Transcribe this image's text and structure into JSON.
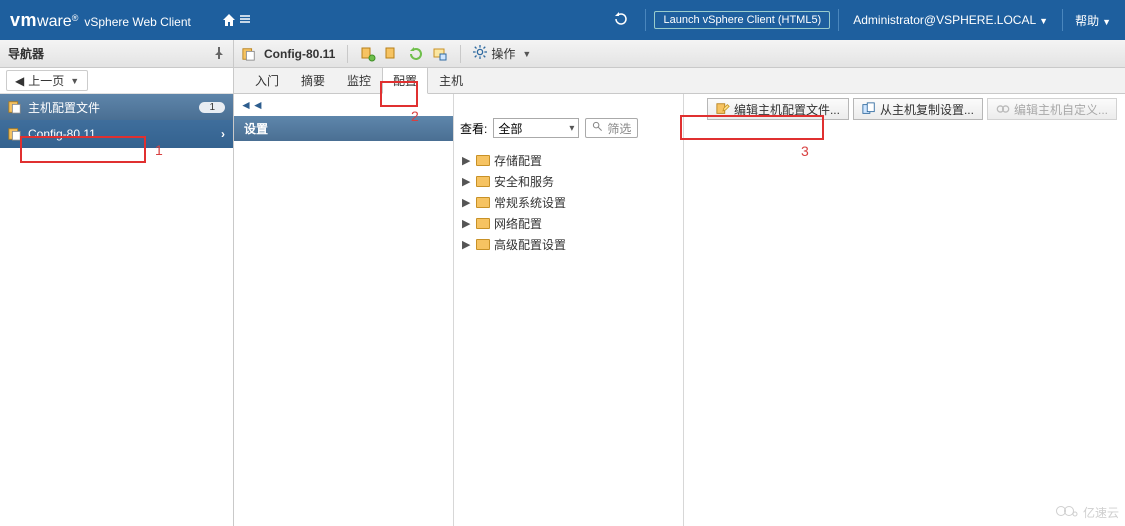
{
  "topbar": {
    "brand_vm": "vm",
    "brand_ware": "ware",
    "brand_reg": "®",
    "brand_product": "vSphere Web Client",
    "launch_label": "Launch vSphere Client (HTML5)",
    "user_label": "Administrator@VSPHERE.LOCAL",
    "help_label": "帮助"
  },
  "navigator": {
    "title": "导航器",
    "back_label": "上一页",
    "category_label": "主机配置文件",
    "category_badge": "1",
    "selected_label": "Config-80.11"
  },
  "objectbar": {
    "name": "Config-80.11",
    "actions_label": "操作"
  },
  "tabs": {
    "t1": "入门",
    "t2": "摘要",
    "t3": "监控",
    "t4": "配置",
    "t5": "主机"
  },
  "settings": {
    "header": "设置",
    "collapse": "◄◄"
  },
  "mid": {
    "view_label": "查看:",
    "view_selected": "全部",
    "filter_placeholder": "筛选",
    "tree": {
      "i1": "存储配置",
      "i2": "安全和服务",
      "i3": "常规系统设置",
      "i4": "网络配置",
      "i5": "高级配置设置"
    }
  },
  "buttons": {
    "b1": "编辑主机配置文件...",
    "b2": "从主机复制设置...",
    "b3": "编辑主机自定义..."
  },
  "annotations": {
    "a1": "1",
    "a2": "2",
    "a3": "3"
  },
  "watermark": {
    "text": "亿速云"
  }
}
